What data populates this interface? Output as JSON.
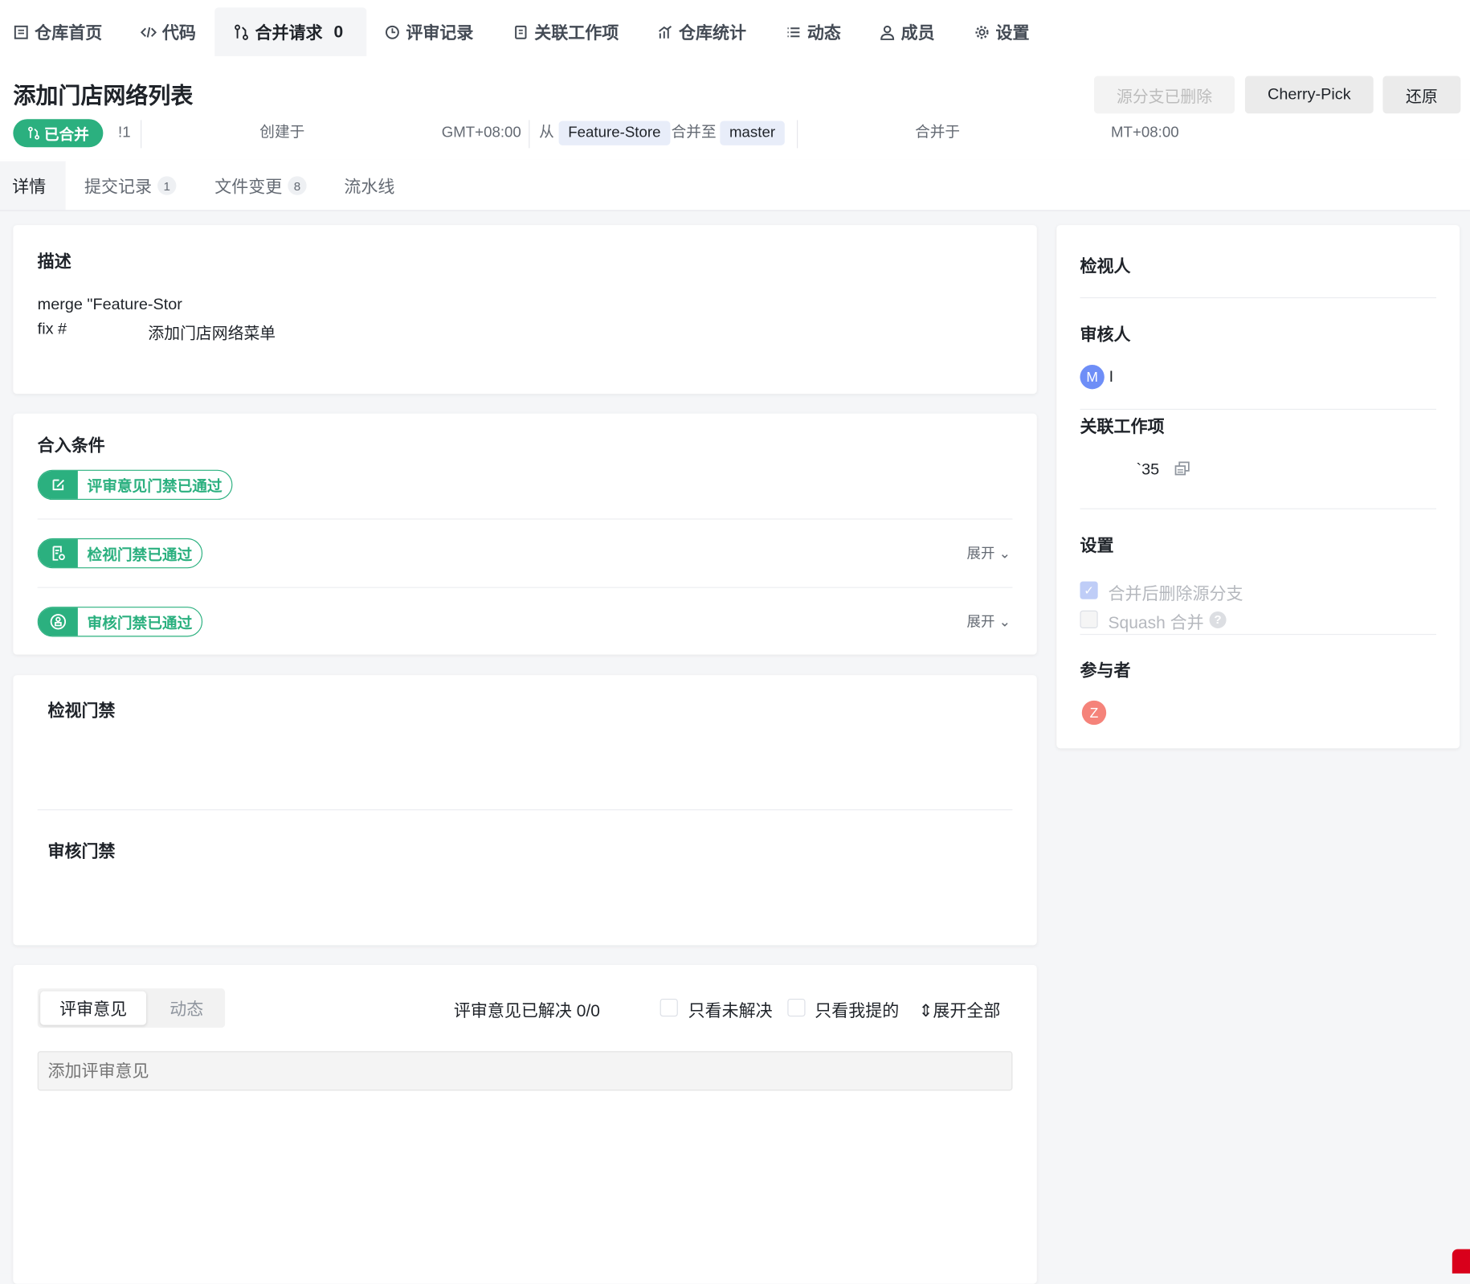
{
  "nav": [
    {
      "label": "仓库首页",
      "icon": "repo-icon"
    },
    {
      "label": "代码",
      "icon": "code-icon"
    },
    {
      "label": "合并请求",
      "icon": "merge-request-icon",
      "count": "0"
    },
    {
      "label": "评审记录",
      "icon": "review-icon"
    },
    {
      "label": "关联工作项",
      "icon": "workitem-icon"
    },
    {
      "label": "仓库统计",
      "icon": "stats-icon"
    },
    {
      "label": "动态",
      "icon": "list-icon"
    },
    {
      "label": "成员",
      "icon": "user-icon"
    },
    {
      "label": "设置",
      "icon": "gear-icon"
    }
  ],
  "title": "添加门店网络列表",
  "actions": {
    "source_deleted": "源分支已删除",
    "cherry_pick": "Cherry-Pick",
    "revert": "还原"
  },
  "meta": {
    "status": "已合并",
    "id": "!1",
    "created": "创建于",
    "created_tz": "GMT+08:00",
    "from": "从",
    "source_branch": "Feature-Store",
    "merge_to": "合并至",
    "target_branch": "master",
    "merged": "合并于",
    "merged_tz": "MT+08:00"
  },
  "subtabs": [
    {
      "label": "详情"
    },
    {
      "label": "提交记录",
      "count": "1"
    },
    {
      "label": "文件变更",
      "count": "8"
    },
    {
      "label": "流水线"
    }
  ],
  "description": {
    "title": "描述",
    "line1": "merge \"Feature-Stor",
    "line2_prefix": "fix #",
    "line2_text": "添加门店网络菜单"
  },
  "conditions": {
    "title": "合入条件",
    "items": [
      {
        "label": "评审意见门禁已通过"
      },
      {
        "label": "检视门禁已通过",
        "expand": "展开"
      },
      {
        "label": "审核门禁已通过",
        "expand": "展开"
      }
    ]
  },
  "gates": {
    "review_gate": "检视门禁",
    "approve_gate": "审核门禁"
  },
  "comments": {
    "tab_comments": "评审意见",
    "tab_activity": "动态",
    "resolved": "评审意见已解决 0/0",
    "only_unresolved": "只看未解决",
    "only_mine": "只看我提的",
    "expand_all": "展开全部",
    "placeholder": "添加评审意见"
  },
  "sidebar": {
    "reviewers": "检视人",
    "approvers": "审核人",
    "approver_avatar": "M",
    "approver_name": "I",
    "workitems": "关联工作项",
    "workitem_id": "`35",
    "settings": "设置",
    "delete_source": "合并后删除源分支",
    "squash": "Squash 合并",
    "participants": "参与者",
    "participant_avatar": "Z"
  },
  "colors": {
    "accent": "#2bb07f",
    "avatar_m": "#6e8ef7",
    "avatar_z": "#f5837a"
  }
}
